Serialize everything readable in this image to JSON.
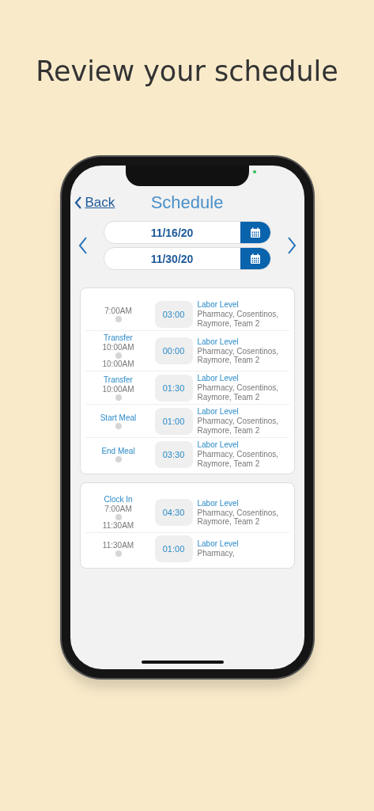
{
  "headline": "Review your schedule",
  "nav": {
    "back": "Back",
    "title": "Schedule"
  },
  "dates": [
    {
      "value": "11/16/20"
    },
    {
      "value": "11/30/20"
    }
  ],
  "cards": [
    {
      "entries": [
        {
          "start": "7:00AM",
          "duration": "03:00",
          "title": "Labor Level",
          "detail": "Pharmacy, Cosentinos, Raymore, Team 2"
        },
        {
          "label": "Transfer",
          "start": "10:00AM",
          "end": "10:00AM",
          "duration": "00:00",
          "title": "Labor Level",
          "detail": "Pharmacy, Cosentinos, Raymore, Team 2"
        },
        {
          "start": "10:00AM",
          "label": "Transfer",
          "duration": "01:30",
          "title": "Labor Level",
          "detail": "Pharmacy, Cosentinos, Raymore, Team 2"
        },
        {
          "label": "Start Meal",
          "duration": "01:00",
          "title": "Labor Level",
          "detail": "Pharmacy, Cosentinos, Raymore, Team 2"
        },
        {
          "label": "End Meal",
          "duration": "03:30",
          "title": "Labor Level",
          "detail": "Pharmacy, Cosentinos, Raymore, Team 2"
        }
      ]
    },
    {
      "entries": [
        {
          "label": "Clock In",
          "start": "7:00AM",
          "end": "11:30AM",
          "duration": "04:30",
          "title": "Labor Level",
          "detail": "Pharmacy, Cosentinos, Raymore, Team 2"
        },
        {
          "start": "11:30AM",
          "duration": "01:00",
          "title": "Labor Level",
          "detail": "Pharmacy,"
        }
      ]
    }
  ]
}
